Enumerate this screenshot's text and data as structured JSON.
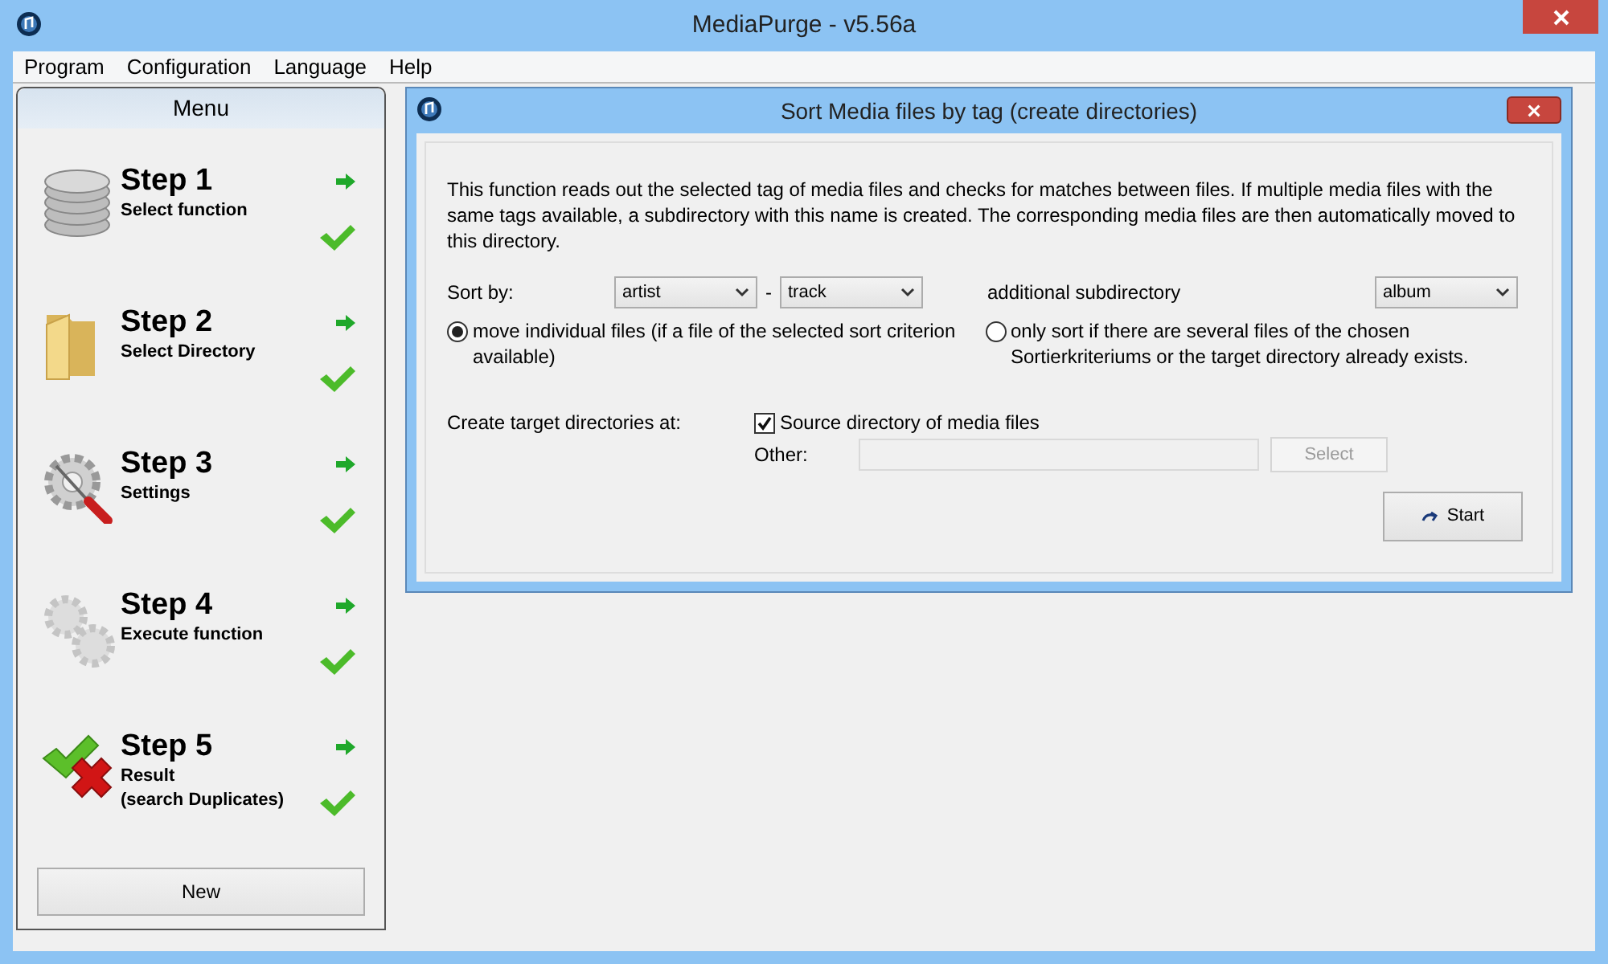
{
  "window": {
    "title": "MediaPurge - v5.56a"
  },
  "menu_bar": [
    "Program",
    "Configuration",
    "Language",
    "Help"
  ],
  "sidebar": {
    "title": "Menu",
    "steps": [
      {
        "kind": "database",
        "title": "Step 1",
        "subtitle": "Select function"
      },
      {
        "kind": "folder",
        "title": "Step 2",
        "subtitle": "Select Directory"
      },
      {
        "kind": "settings",
        "title": "Step 3",
        "subtitle": "Settings"
      },
      {
        "kind": "gears",
        "title": "Step 4",
        "subtitle": "Execute function"
      },
      {
        "kind": "result",
        "title": "Step 5",
        "subtitle": "Result\n(search Duplicates)"
      }
    ],
    "button": "New"
  },
  "dialog": {
    "title": "Sort Media files by tag (create directories)",
    "description": "This function reads out the selected tag of media files and checks for matches between files. If multiple media files with the same tags available, a subdirectory with this name is created. The corresponding media files are then automatically moved to this directory.",
    "sort_label": "Sort by:",
    "sort_first": "artist",
    "separator": "-",
    "sort_second": "track",
    "subdir_label": "additional subdirectory",
    "subdir_value": "album",
    "options": [
      {
        "label": "move individual files (if a file of the selected sort criterion available)",
        "selected": true
      },
      {
        "label": "only sort if there are several files of the chosen Sortierkriteriums or the target directory already exists.",
        "selected": false
      }
    ],
    "target_label": "Create target directories at:",
    "source_checkbox": {
      "label": "Source directory of media files",
      "checked": true
    },
    "other_label": "Other:",
    "select_button": {
      "label": "Select",
      "disabled": true
    },
    "start_button": "Start"
  }
}
